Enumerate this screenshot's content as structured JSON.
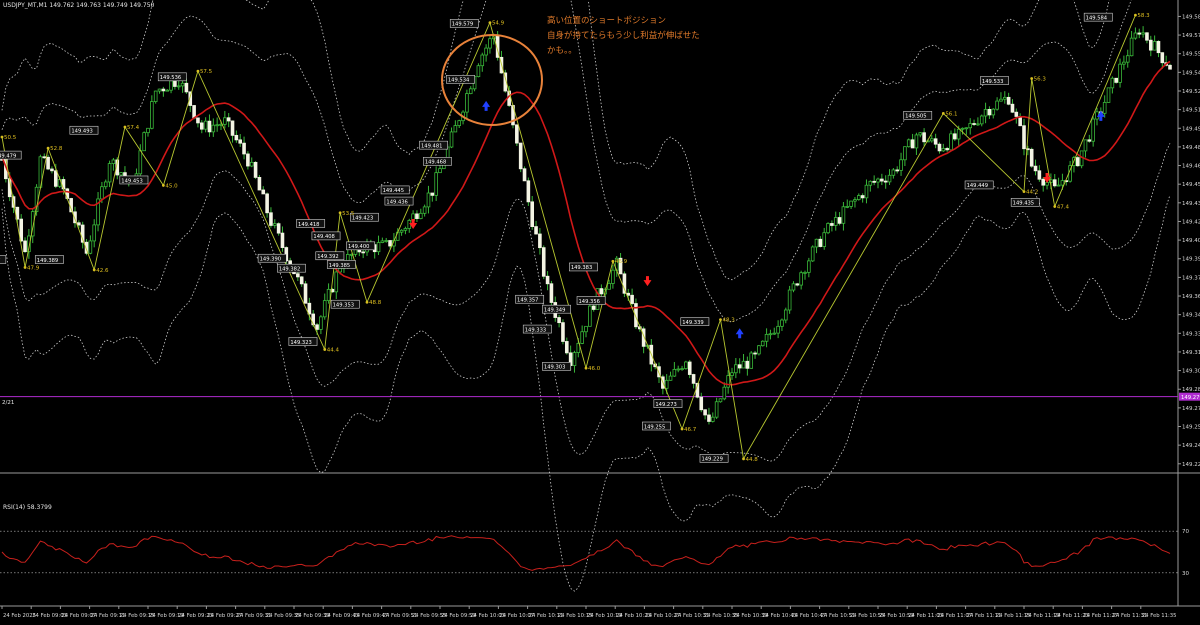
{
  "header": {
    "symbol_info": "USDJPY_MT,M1  149.762 149.763 149.749 149.750"
  },
  "annotation": {
    "lines": [
      "高い位置のショートポジション",
      "自身が持てたらもう少し利益が伸ばせた",
      "かも。。"
    ],
    "color": "#e07a2a"
  },
  "level_line": {
    "label": "2/21",
    "value": 149.279,
    "value_text": "149.279",
    "color": "#b02bd0"
  },
  "price_axis": {
    "ticks": [
      "149.585",
      "149.570",
      "149.555",
      "149.540",
      "149.525",
      "149.510",
      "149.495",
      "149.480",
      "149.465",
      "149.450",
      "149.435",
      "149.420",
      "149.405",
      "149.390",
      "149.375",
      "149.360",
      "149.345",
      "149.330",
      "149.315",
      "149.300",
      "149.285",
      "149.270",
      "149.255",
      "149.240",
      "149.225"
    ]
  },
  "time_axis": {
    "ticks": [
      "24 Feb 2025",
      "24 Feb 09:03",
      "24 Feb 09:07",
      "24 Feb 09:11",
      "24 Feb 09:15",
      "24 Feb 09:19",
      "24 Feb 09:23",
      "24 Feb 09:27",
      "24 Feb 09:31",
      "24 Feb 09:35",
      "24 Feb 09:39",
      "24 Feb 09:43",
      "24 Feb 09:47",
      "24 Feb 09:51",
      "24 Feb 09:55",
      "24 Feb 09:59",
      "24 Feb 10:03",
      "24 Feb 10:07",
      "24 Feb 10:11",
      "24 Feb 10:15",
      "24 Feb 10:19",
      "24 Feb 10:23",
      "24 Feb 10:27",
      "24 Feb 10:31",
      "24 Feb 10:35",
      "24 Feb 10:39",
      "24 Feb 10:43",
      "24 Feb 10:47",
      "24 Feb 10:51",
      "24 Feb 10:55",
      "24 Feb 10:59",
      "24 Feb 11:03",
      "24 Feb 11:07",
      "24 Feb 11:11",
      "24 Feb 11:15",
      "24 Feb 11:19",
      "24 Feb 11:23",
      "24 Feb 11:27",
      "24 Feb 11:31",
      "24 Feb 11:35"
    ]
  },
  "rsi_panel": {
    "label": "RSI(14) 58.3799",
    "levels": [
      70,
      30
    ],
    "level_texts": [
      "70",
      "30"
    ],
    "color": "#c8201c"
  },
  "chart_data": {
    "type": "candlestick",
    "instrument": "USDJPY_MT",
    "timeframe": "M1",
    "ylim": [
      149.22,
      149.595
    ],
    "grid": false,
    "price_anchors": [
      [
        0,
        149.47
      ],
      [
        6,
        149.395
      ],
      [
        10,
        149.47
      ],
      [
        16,
        149.445
      ],
      [
        22,
        149.395
      ],
      [
        28,
        149.47
      ],
      [
        34,
        149.45
      ],
      [
        40,
        149.525
      ],
      [
        46,
        149.535
      ],
      [
        52,
        149.495
      ],
      [
        58,
        149.5
      ],
      [
        64,
        149.47
      ],
      [
        70,
        149.42
      ],
      [
        76,
        149.38
      ],
      [
        82,
        149.335
      ],
      [
        88,
        149.385
      ],
      [
        94,
        149.4
      ],
      [
        100,
        149.4
      ],
      [
        106,
        149.42
      ],
      [
        112,
        149.445
      ],
      [
        118,
        149.495
      ],
      [
        124,
        149.55
      ],
      [
        128,
        149.57
      ],
      [
        132,
        149.51
      ],
      [
        136,
        149.45
      ],
      [
        142,
        149.365
      ],
      [
        148,
        149.31
      ],
      [
        154,
        149.355
      ],
      [
        160,
        149.385
      ],
      [
        166,
        149.33
      ],
      [
        172,
        149.285
      ],
      [
        178,
        149.31
      ],
      [
        184,
        149.255
      ],
      [
        190,
        149.3
      ],
      [
        196,
        149.31
      ],
      [
        202,
        149.34
      ],
      [
        208,
        149.38
      ],
      [
        214,
        149.41
      ],
      [
        220,
        149.43
      ],
      [
        226,
        149.45
      ],
      [
        232,
        149.46
      ],
      [
        238,
        149.49
      ],
      [
        244,
        149.48
      ],
      [
        250,
        149.49
      ],
      [
        256,
        149.51
      ],
      [
        262,
        149.52
      ],
      [
        268,
        149.465
      ],
      [
        274,
        149.445
      ],
      [
        280,
        149.47
      ],
      [
        286,
        149.51
      ],
      [
        292,
        149.55
      ],
      [
        296,
        149.575
      ],
      [
        300,
        149.56
      ],
      [
        304,
        149.545
      ]
    ],
    "bands_ma_rsi_note": "Bollinger-style envelope (dotted white), moving average (red), RSI(14) in lower panel",
    "zigzag_labels": [
      {
        "text": "149.307",
        "price": 149.389,
        "index": 1
      },
      {
        "text": "49.479",
        "price": 149.473,
        "index": 5
      },
      {
        "text": "149.389",
        "price": 149.389,
        "index": 16
      },
      {
        "text": "149.493",
        "price": 149.493,
        "index": 25
      },
      {
        "text": "149.453",
        "price": 149.453,
        "index": 38
      },
      {
        "text": "149.536",
        "price": 149.536,
        "index": 48
      },
      {
        "text": "149.418",
        "price": 149.418,
        "index": 84
      },
      {
        "text": "149.390",
        "price": 149.39,
        "index": 74
      },
      {
        "text": "149.382",
        "price": 149.382,
        "index": 79
      },
      {
        "text": "149.323",
        "price": 149.323,
        "index": 82
      },
      {
        "text": "149.423",
        "price": 149.423,
        "index": 98
      },
      {
        "text": "149.408",
        "price": 149.408,
        "index": 88
      },
      {
        "text": "149.400",
        "price": 149.4,
        "index": 97
      },
      {
        "text": "149.392",
        "price": 149.392,
        "index": 89
      },
      {
        "text": "149.385",
        "price": 149.385,
        "index": 92
      },
      {
        "text": "149.353",
        "price": 149.353,
        "index": 93
      },
      {
        "text": "149.445",
        "price": 149.445,
        "index": 106
      },
      {
        "text": "149.436",
        "price": 149.436,
        "index": 107
      },
      {
        "text": "149.481",
        "price": 149.481,
        "index": 116
      },
      {
        "text": "149.468",
        "price": 149.468,
        "index": 117
      },
      {
        "text": "149.534",
        "price": 149.534,
        "index": 123
      },
      {
        "text": "149.579",
        "price": 149.579,
        "index": 124
      },
      {
        "text": "149.357",
        "price": 149.357,
        "index": 141
      },
      {
        "text": "149.356",
        "price": 149.356,
        "index": 157
      },
      {
        "text": "149.349",
        "price": 149.349,
        "index": 148
      },
      {
        "text": "149.333",
        "price": 149.333,
        "index": 143
      },
      {
        "text": "149.303",
        "price": 149.303,
        "index": 148
      },
      {
        "text": "149.383",
        "price": 149.383,
        "index": 155
      },
      {
        "text": "149.273",
        "price": 149.273,
        "index": 177
      },
      {
        "text": "149.255",
        "price": 149.255,
        "index": 174
      },
      {
        "text": "149.339",
        "price": 149.339,
        "index": 184
      },
      {
        "text": "149.229",
        "price": 149.229,
        "index": 189
      },
      {
        "text": "149.505",
        "price": 149.505,
        "index": 242
      },
      {
        "text": "149.449",
        "price": 149.449,
        "index": 258
      },
      {
        "text": "149.533",
        "price": 149.533,
        "index": 262
      },
      {
        "text": "149.435",
        "price": 149.435,
        "index": 270
      },
      {
        "text": "149.584",
        "price": 149.584,
        "index": 289
      }
    ],
    "zigzag_peak_labels": [
      {
        "text": "50.5",
        "price": 149.488,
        "index": 0
      },
      {
        "text": "47.9",
        "price": 149.383,
        "index": 6
      },
      {
        "text": "52.8",
        "price": 149.479,
        "index": 12
      },
      {
        "text": "42.6",
        "price": 149.381,
        "index": 24
      },
      {
        "text": "57.4",
        "price": 149.496,
        "index": 32
      },
      {
        "text": "45.0",
        "price": 149.449,
        "index": 42
      },
      {
        "text": "57.5",
        "price": 149.541,
        "index": 51
      },
      {
        "text": "53.5",
        "price": 149.427,
        "index": 88
      },
      {
        "text": "44.4",
        "price": 149.317,
        "index": 84
      },
      {
        "text": "48.8",
        "price": 149.355,
        "index": 95
      },
      {
        "text": "54.9",
        "price": 149.58,
        "index": 127
      },
      {
        "text": "46.9",
        "price": 149.388,
        "index": 159
      },
      {
        "text": "46.0",
        "price": 149.302,
        "index": 152
      },
      {
        "text": "48.3",
        "price": 149.341,
        "index": 187
      },
      {
        "text": "46.7",
        "price": 149.253,
        "index": 177
      },
      {
        "text": "44.8",
        "price": 149.229,
        "index": 193
      },
      {
        "text": "56.1",
        "price": 149.507,
        "index": 245
      },
      {
        "text": "56.3",
        "price": 149.535,
        "index": 268
      },
      {
        "text": "44.2",
        "price": 149.444,
        "index": 266
      },
      {
        "text": "47.4",
        "price": 149.432,
        "index": 274
      },
      {
        "text": "58.3",
        "price": 149.586,
        "index": 295
      }
    ]
  }
}
